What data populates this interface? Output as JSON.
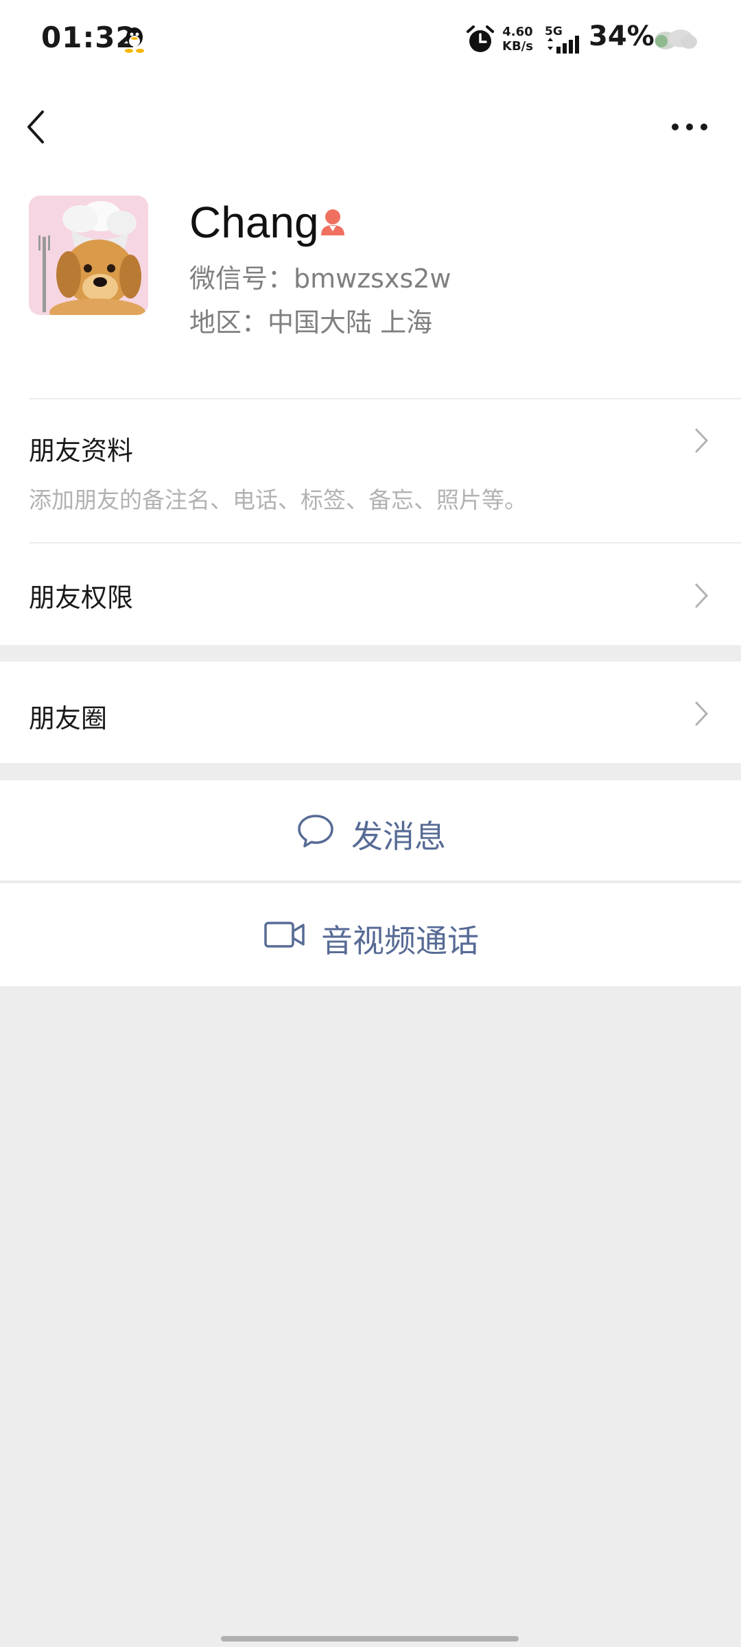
{
  "status_bar": {
    "time": "01:32",
    "speed_value": "4.60",
    "speed_unit": "KB/s",
    "network": "5G",
    "battery": "34%"
  },
  "nav": {
    "back_icon": "chevron-left-icon",
    "more_icon": "more-dots-icon"
  },
  "profile": {
    "name": "Chang",
    "gender_icon": "female-icon",
    "wechat_id": "微信号：bmwzsxs2w",
    "region": "地区：中国大陆  上海"
  },
  "menu": {
    "friend_info_title": "朋友资料",
    "friend_info_sub": "添加朋友的备注名、电话、标签、备忘、照片等。",
    "friend_permission": "朋友权限",
    "moments": "朋友圈"
  },
  "actions": {
    "send_message": "发消息",
    "av_call": "音视频通话"
  },
  "colors": {
    "accent_link": "#576b95",
    "background": "#ededed",
    "gender_female": "#f07060"
  }
}
